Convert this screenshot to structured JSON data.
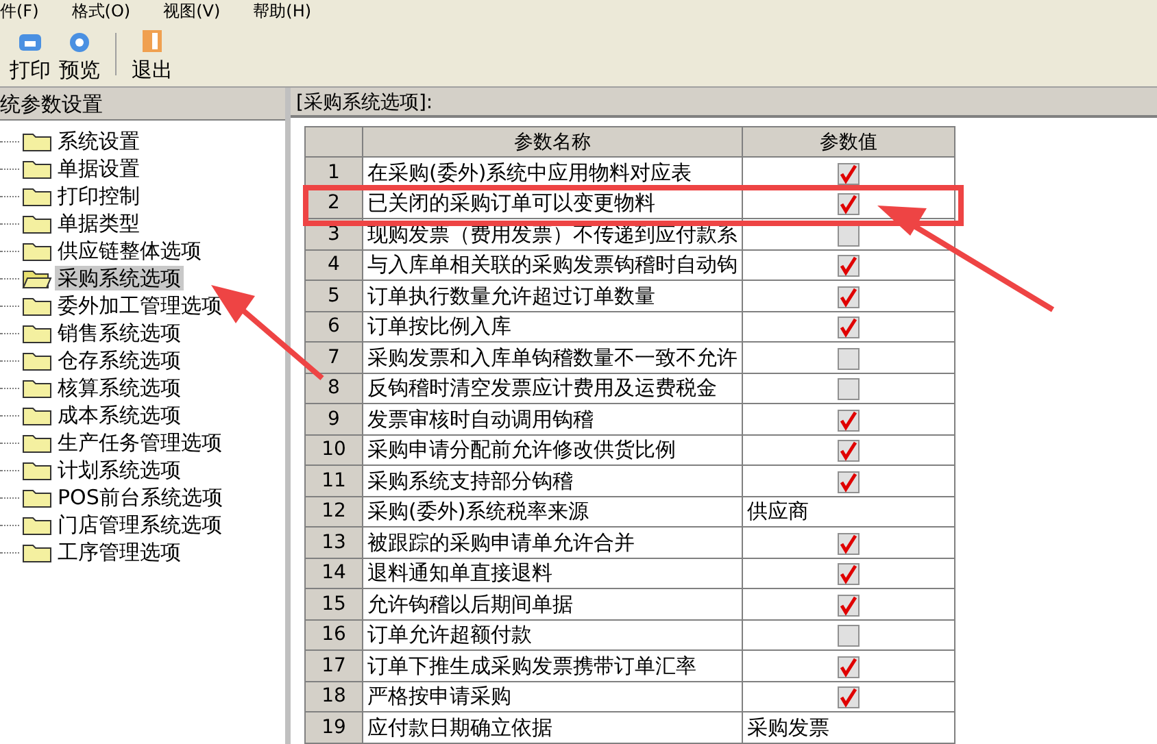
{
  "menu": [
    "件(F)",
    "格式(O)",
    "视图(V)",
    "帮助(H)"
  ],
  "toolbar": [
    {
      "kind": "print",
      "label": "打印"
    },
    {
      "kind": "preview",
      "label": "预览"
    },
    {
      "kind": "exit",
      "label": "退出"
    }
  ],
  "tree": {
    "title": "统参数设置",
    "items": [
      {
        "label": "系统设置",
        "selected": false
      },
      {
        "label": "单据设置",
        "selected": false
      },
      {
        "label": "打印控制",
        "selected": false
      },
      {
        "label": "单据类型",
        "selected": false
      },
      {
        "label": "供应链整体选项",
        "selected": false
      },
      {
        "label": "采购系统选项",
        "selected": true
      },
      {
        "label": "委外加工管理选项",
        "selected": false
      },
      {
        "label": "销售系统选项",
        "selected": false
      },
      {
        "label": "仓存系统选项",
        "selected": false
      },
      {
        "label": "核算系统选项",
        "selected": false
      },
      {
        "label": "成本系统选项",
        "selected": false
      },
      {
        "label": "生产任务管理选项",
        "selected": false
      },
      {
        "label": "计划系统选项",
        "selected": false
      },
      {
        "label": "POS前台系统选项",
        "selected": false
      },
      {
        "label": "门店管理系统选项",
        "selected": false
      },
      {
        "label": "工序管理选项",
        "selected": false
      }
    ]
  },
  "panel": {
    "title": "[采购系统选项]:",
    "columns": [
      "参数名称",
      "参数值"
    ],
    "rows": [
      {
        "no": "1",
        "name": "在采购(委外)系统中应用物料对应表",
        "kind": "checkbox",
        "checked": true
      },
      {
        "no": "2",
        "name": "已关闭的采购订单可以变更物料",
        "kind": "checkbox",
        "checked": true
      },
      {
        "no": "3",
        "name": "现购发票（费用发票）不传递到应付款系",
        "kind": "checkbox",
        "checked": false
      },
      {
        "no": "4",
        "name": "与入库单相关联的采购发票钩稽时自动钩",
        "kind": "checkbox",
        "checked": true
      },
      {
        "no": "5",
        "name": "订单执行数量允许超过订单数量",
        "kind": "checkbox",
        "checked": true
      },
      {
        "no": "6",
        "name": "订单按比例入库",
        "kind": "checkbox",
        "checked": true
      },
      {
        "no": "7",
        "name": "采购发票和入库单钩稽数量不一致不允许",
        "kind": "checkbox",
        "checked": false
      },
      {
        "no": "8",
        "name": "反钩稽时清空发票应计费用及运费税金",
        "kind": "checkbox",
        "checked": false
      },
      {
        "no": "9",
        "name": "发票审核时自动调用钩稽",
        "kind": "checkbox",
        "checked": true
      },
      {
        "no": "10",
        "name": "采购申请分配前允许修改供货比例",
        "kind": "checkbox",
        "checked": true
      },
      {
        "no": "11",
        "name": "采购系统支持部分钩稽",
        "kind": "checkbox",
        "checked": true
      },
      {
        "no": "12",
        "name": "采购(委外)系统税率来源",
        "kind": "text",
        "value": "供应商"
      },
      {
        "no": "13",
        "name": "被跟踪的采购申请单允许合并",
        "kind": "checkbox",
        "checked": true
      },
      {
        "no": "14",
        "name": "退料通知单直接退料",
        "kind": "checkbox",
        "checked": true
      },
      {
        "no": "15",
        "name": "允许钩稽以后期间单据",
        "kind": "checkbox",
        "checked": true
      },
      {
        "no": "16",
        "name": "订单允许超额付款",
        "kind": "checkbox",
        "checked": false
      },
      {
        "no": "17",
        "name": "订单下推生成采购发票携带订单汇率",
        "kind": "checkbox",
        "checked": true
      },
      {
        "no": "18",
        "name": "严格按申请采购",
        "kind": "checkbox",
        "checked": true
      },
      {
        "no": "19",
        "name": "应付款日期确立依据",
        "kind": "text",
        "value": "采购发票"
      }
    ]
  }
}
